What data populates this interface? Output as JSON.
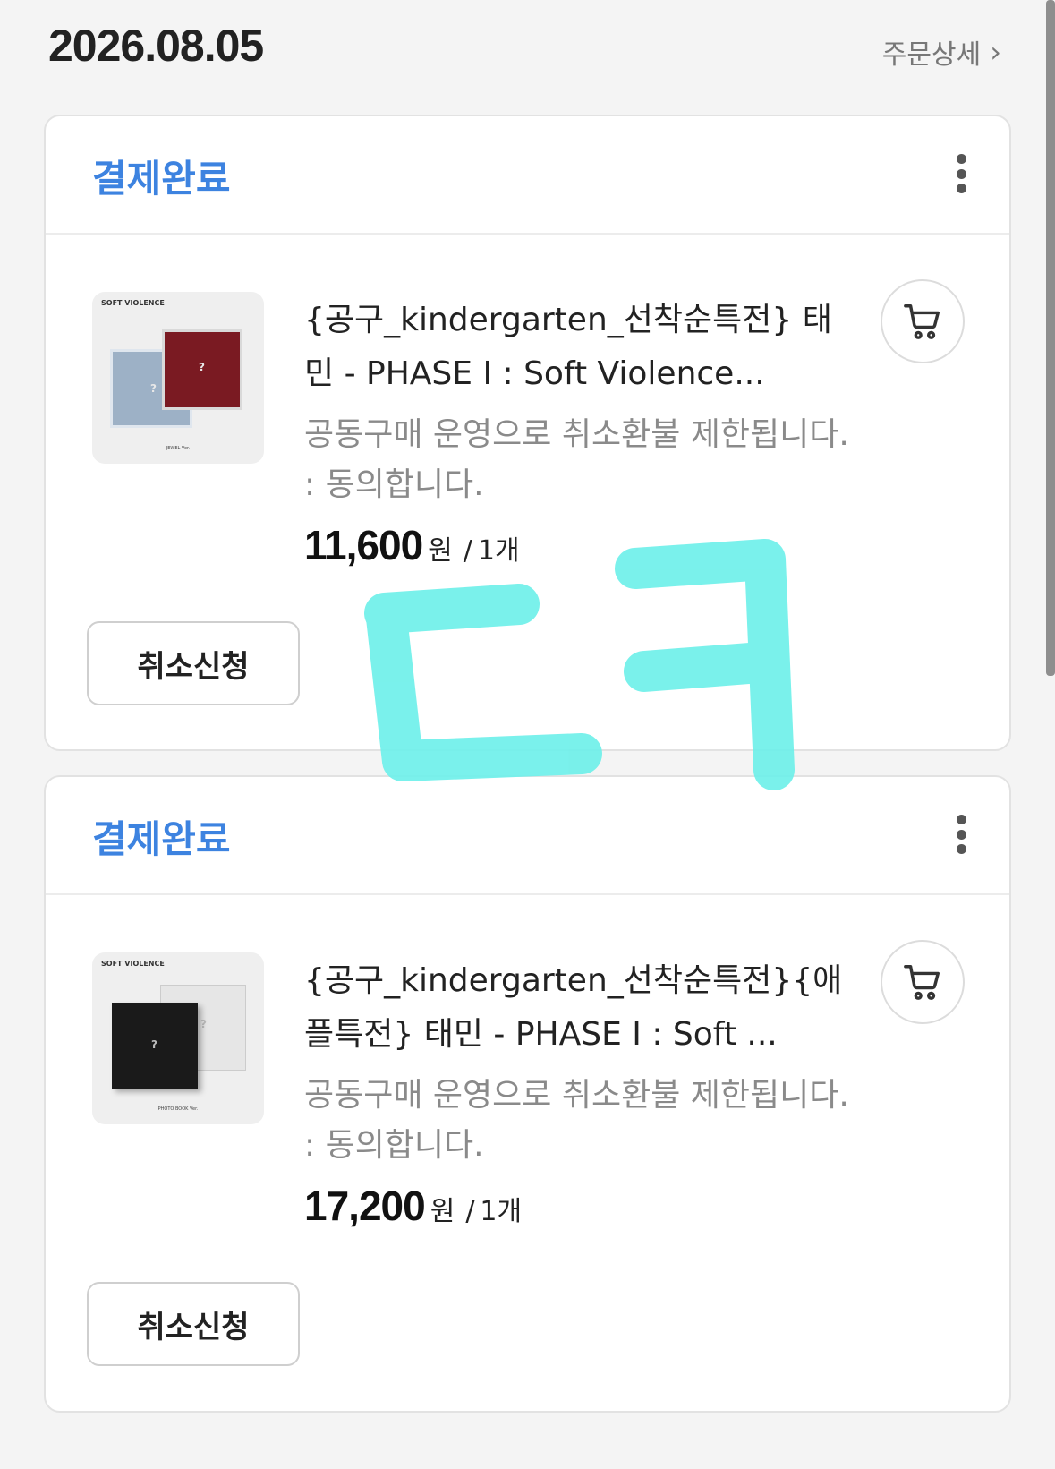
{
  "header": {
    "date": "2026.08.05",
    "detail_link": "주문상세",
    "chevron_icon": "chevron-right-icon"
  },
  "orders": [
    {
      "status": "결제완료",
      "product": {
        "name": "{공구_kindergarten_선착순특전} 태민 - PHASE I : Soft Violence...",
        "thumbnail_title": "SOFT VIOLENCE",
        "thumbnail_caption": "JEWEL Ver.",
        "notice": "공동구매 운영으로 취소환불 제한됩니다. : 동의합니다.",
        "price": "11,600",
        "currency": "원",
        "separator": "/",
        "quantity": "1개"
      },
      "cancel_label": "취소신청"
    },
    {
      "status": "결제완료",
      "product": {
        "name": "{공구_kindergarten_선착순특전}{애플특전} 태민 - PHASE I : Soft ...",
        "thumbnail_title": "SOFT VIOLENCE",
        "thumbnail_caption": "PHOTO BOOK Ver.",
        "notice": "공동구매 운영으로 취소환불 제한됩니다. : 동의합니다.",
        "price": "17,200",
        "currency": "원",
        "separator": "/",
        "quantity": "1개"
      },
      "cancel_label": "취소신청"
    }
  ],
  "colors": {
    "status_blue": "#3d83e0",
    "scribble_cyan": "#6ff0ea",
    "background": "#f4f4f4"
  },
  "icons": [
    "more-vertical-icon",
    "cart-icon",
    "chevron-right-icon"
  ]
}
